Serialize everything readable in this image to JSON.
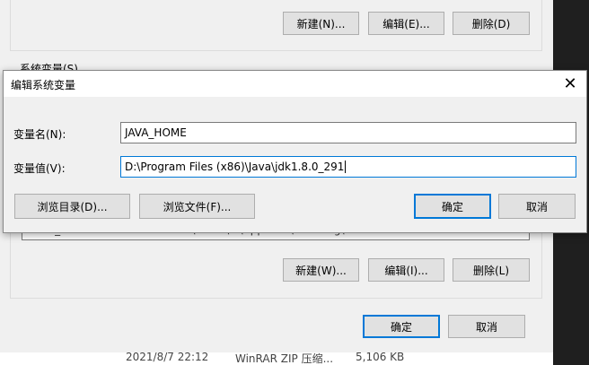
{
  "parent": {
    "top_buttons": {
      "new": "新建(N)...",
      "edit": "编辑(E)...",
      "delete": "删除(D)"
    },
    "system_group_title": "系统变量(S)",
    "row_name": "PATH_HOME",
    "row_value": "C:\\Users\\...\\AppData\\Roaming\\...",
    "bottom_buttons": {
      "new": "新建(W)...",
      "edit": "编辑(I)...",
      "delete": "删除(L)"
    },
    "ok": "确定",
    "cancel": "取消"
  },
  "explorer": {
    "date": "2021/8/7 22:12",
    "type": "WinRAR ZIP 压缩...",
    "size": "5,106 KB"
  },
  "dialog": {
    "title": "编辑系统变量",
    "name_label": "变量名(N):",
    "name_value": "JAVA_HOME",
    "value_label": "变量值(V):",
    "value_value": "D:\\Program Files (x86)\\Java\\jdk1.8.0_291",
    "browse_dir": "浏览目录(D)...",
    "browse_file": "浏览文件(F)...",
    "ok": "确定",
    "cancel": "取消",
    "close_glyph": "✕"
  }
}
